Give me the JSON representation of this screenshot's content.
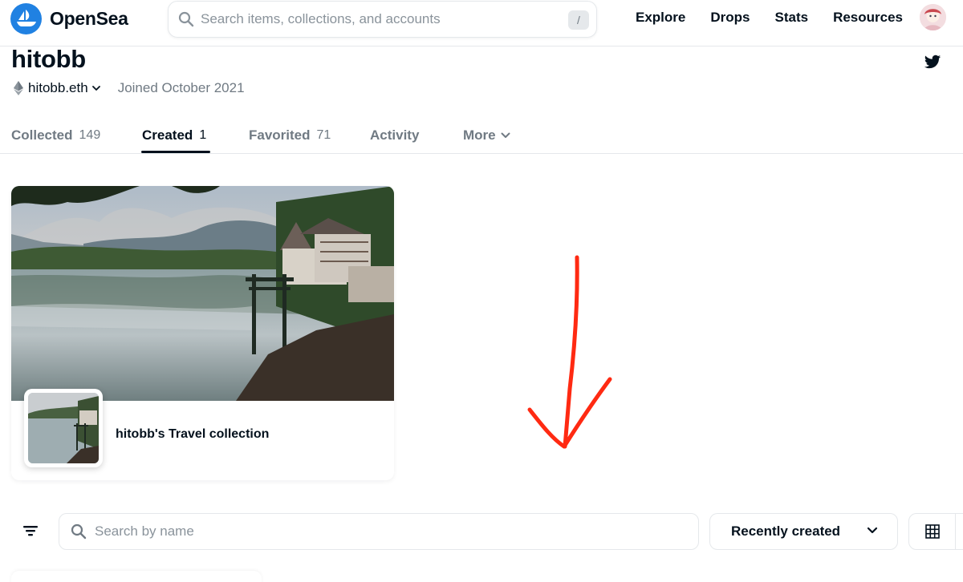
{
  "navbar": {
    "brand": "OpenSea",
    "search_placeholder": "Search items, collections, and accounts",
    "search_shortcut": "/",
    "links": [
      "Explore",
      "Drops",
      "Stats",
      "Resources"
    ]
  },
  "profile": {
    "username": "hitobb",
    "ens": "hitobb.eth",
    "joined": "Joined October 2021"
  },
  "tabs": [
    {
      "label": "Collected",
      "count": "149"
    },
    {
      "label": "Created",
      "count": "1"
    },
    {
      "label": "Favorited",
      "count": "71"
    },
    {
      "label": "Activity",
      "count": ""
    },
    {
      "label": "More",
      "count": ""
    }
  ],
  "active_tab": "Created",
  "collection": {
    "title": "hitobb's Travel collection"
  },
  "filters": {
    "search_placeholder": "Search by name",
    "sort_selected": "Recently created"
  },
  "colors": {
    "brand_blue": "#2081e2",
    "text_primary": "#04111d",
    "text_secondary": "#707a83",
    "border": "#e5e8eb",
    "annotation_red": "#ff2a12"
  },
  "icons": {
    "logo": "opensea-ship-icon",
    "search": "search-icon",
    "social": "twitter-icon",
    "chain": "ethereum-icon",
    "filter": "filter-icon",
    "sort": "chevron-down-icon",
    "view": "grid-view-icon"
  }
}
